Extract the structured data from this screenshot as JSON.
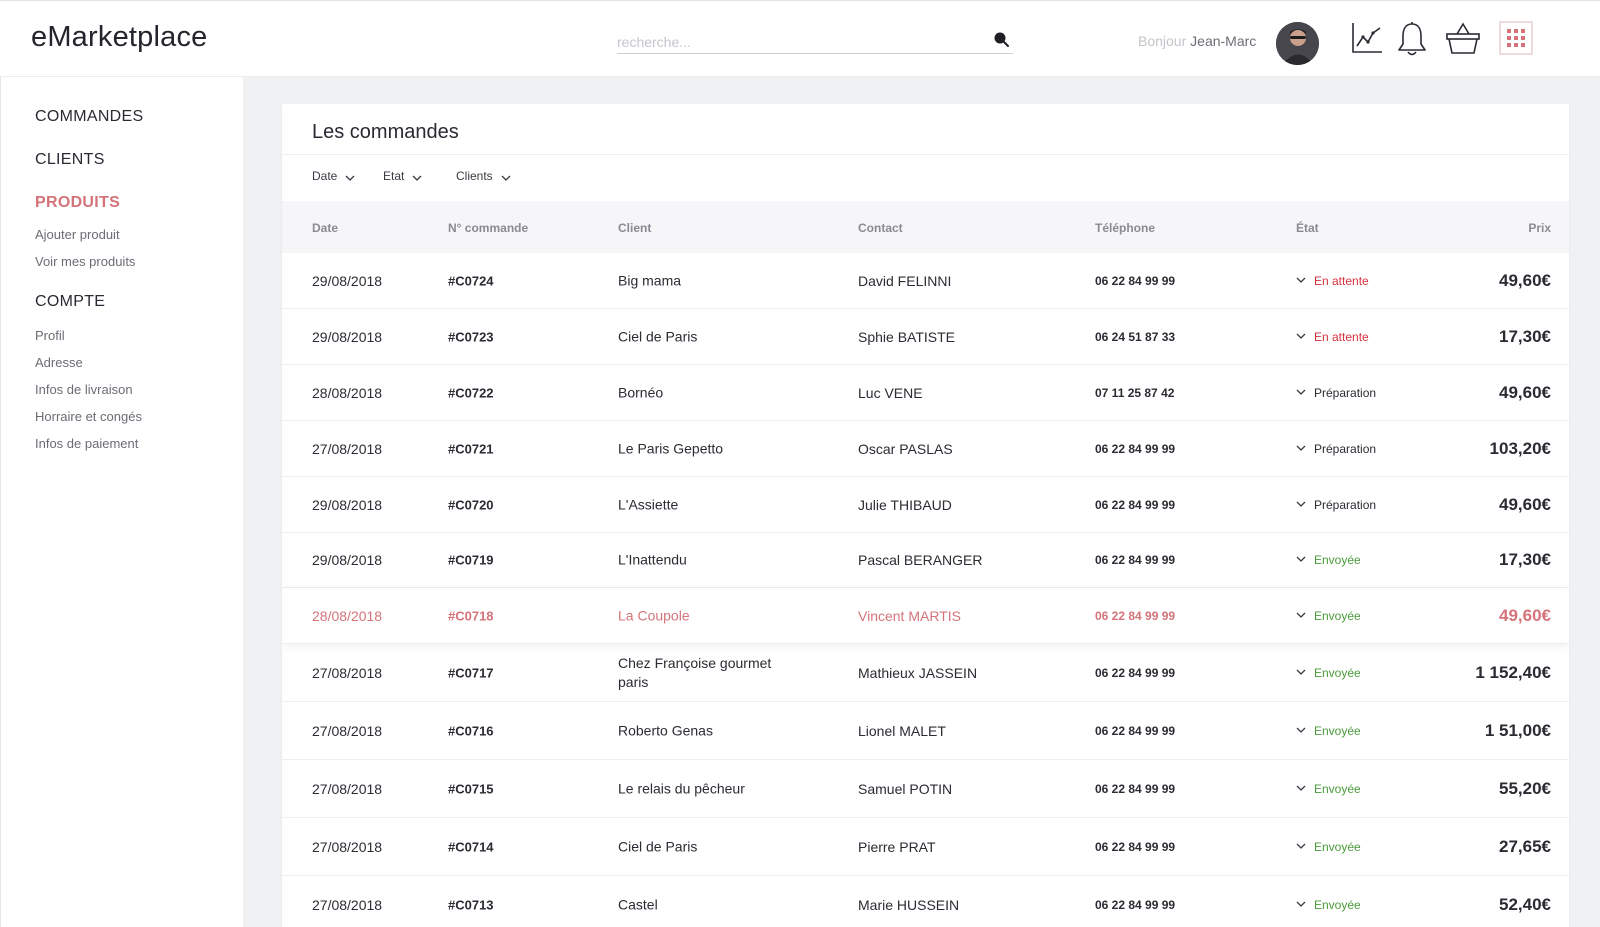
{
  "app": {
    "name": "eMarketplace",
    "search_placeholder": "recherche...",
    "greeting": "Bonjour",
    "user": "Jean-Marc"
  },
  "icons": {
    "search": "search-icon",
    "stats": "chart-icon",
    "notifications": "bell-icon",
    "cart": "basket-icon",
    "apps": "grid-icon"
  },
  "colors": {
    "accent": "#d4747a",
    "pending": "#d6303e",
    "sent": "#4a9a3b"
  },
  "sidebar": {
    "commandes": "COMMANDES",
    "clients": "CLIENTS",
    "produits": "PRODUITS",
    "produits_items": [
      "Ajouter produit",
      "Voir mes produits"
    ],
    "compte": "COMPTE",
    "compte_items": [
      "Profil",
      "Adresse",
      "Infos de livraison",
      "Horraire et congés",
      "Infos de paiement"
    ]
  },
  "main": {
    "title": "Les commandes",
    "filters": [
      "Date",
      "Etat",
      "Clients"
    ],
    "columns": {
      "date": "Date",
      "num": "N° commande",
      "client": "Client",
      "contact": "Contact",
      "phone": "Téléphone",
      "state": "État",
      "price": "Prix"
    },
    "orders": [
      {
        "date": "29/08/2018",
        "num": "#C0724",
        "client": "Big mama",
        "contact": "David FELINNI",
        "phone": "06 22 84 99 99",
        "state": "En attente",
        "status": "pending",
        "price": "49,60€"
      },
      {
        "date": "29/08/2018",
        "num": "#C0723",
        "client": "Ciel de Paris",
        "contact": "Sphie BATISTE",
        "phone": "06 24 51 87 33",
        "state": "En attente",
        "status": "pending",
        "price": "17,30€"
      },
      {
        "date": "28/08/2018",
        "num": "#C0722",
        "client": "Bornéo",
        "contact": "Luc VENE",
        "phone": "07 11 25 87 42",
        "state": "Préparation",
        "status": "prep",
        "price": "49,60€"
      },
      {
        "date": "27/08/2018",
        "num": "#C0721",
        "client": "Le Paris Gepetto",
        "contact": "Oscar PASLAS",
        "phone": "06 22 84 99 99",
        "state": "Préparation",
        "status": "prep",
        "price": "103,20€"
      },
      {
        "date": "29/08/2018",
        "num": "#C0720",
        "client": "L'Assiette",
        "contact": "Julie THIBAUD",
        "phone": "06 22 84 99 99",
        "state": "Préparation",
        "status": "prep",
        "price": "49,60€"
      },
      {
        "date": "29/08/2018",
        "num": "#C0719",
        "client": "L'Inattendu",
        "contact": "Pascal BERANGER",
        "phone": "06 22 84 99 99",
        "state": "Envoyée",
        "status": "sent",
        "price": "17,30€"
      },
      {
        "date": "28/08/2018",
        "num": "#C0718",
        "client": "La Coupole",
        "contact": "Vincent MARTIS",
        "phone": "06 22 84 99 99",
        "state": "Envoyée",
        "status": "sent",
        "price": "49,60€",
        "highlight": true
      },
      {
        "date": "27/08/2018",
        "num": "#C0717",
        "client": "Chez Françoise gourmet paris",
        "contact": "Mathieux JASSEIN",
        "phone": "06 22 84 99 99",
        "state": "Envoyée",
        "status": "sent",
        "price": "1 152,40€"
      },
      {
        "date": "27/08/2018",
        "num": "#C0716",
        "client": "Roberto Genas",
        "contact": "Lionel MALET",
        "phone": "06 22 84 99 99",
        "state": "Envoyée",
        "status": "sent",
        "price": "1 51,00€"
      },
      {
        "date": "27/08/2018",
        "num": "#C0715",
        "client": "Le relais du pêcheur",
        "contact": "Samuel POTIN",
        "phone": "06 22 84 99 99",
        "state": "Envoyée",
        "status": "sent",
        "price": "55,20€"
      },
      {
        "date": "27/08/2018",
        "num": "#C0714",
        "client": "Ciel de Paris",
        "contact": "Pierre PRAT",
        "phone": "06 22 84 99 99",
        "state": "Envoyée",
        "status": "sent",
        "price": "27,65€"
      },
      {
        "date": "27/08/2018",
        "num": "#C0713",
        "client": "Castel",
        "contact": "Marie HUSSEIN",
        "phone": "06 22 84 99 99",
        "state": "Envoyée",
        "status": "sent",
        "price": "52,40€"
      }
    ]
  }
}
